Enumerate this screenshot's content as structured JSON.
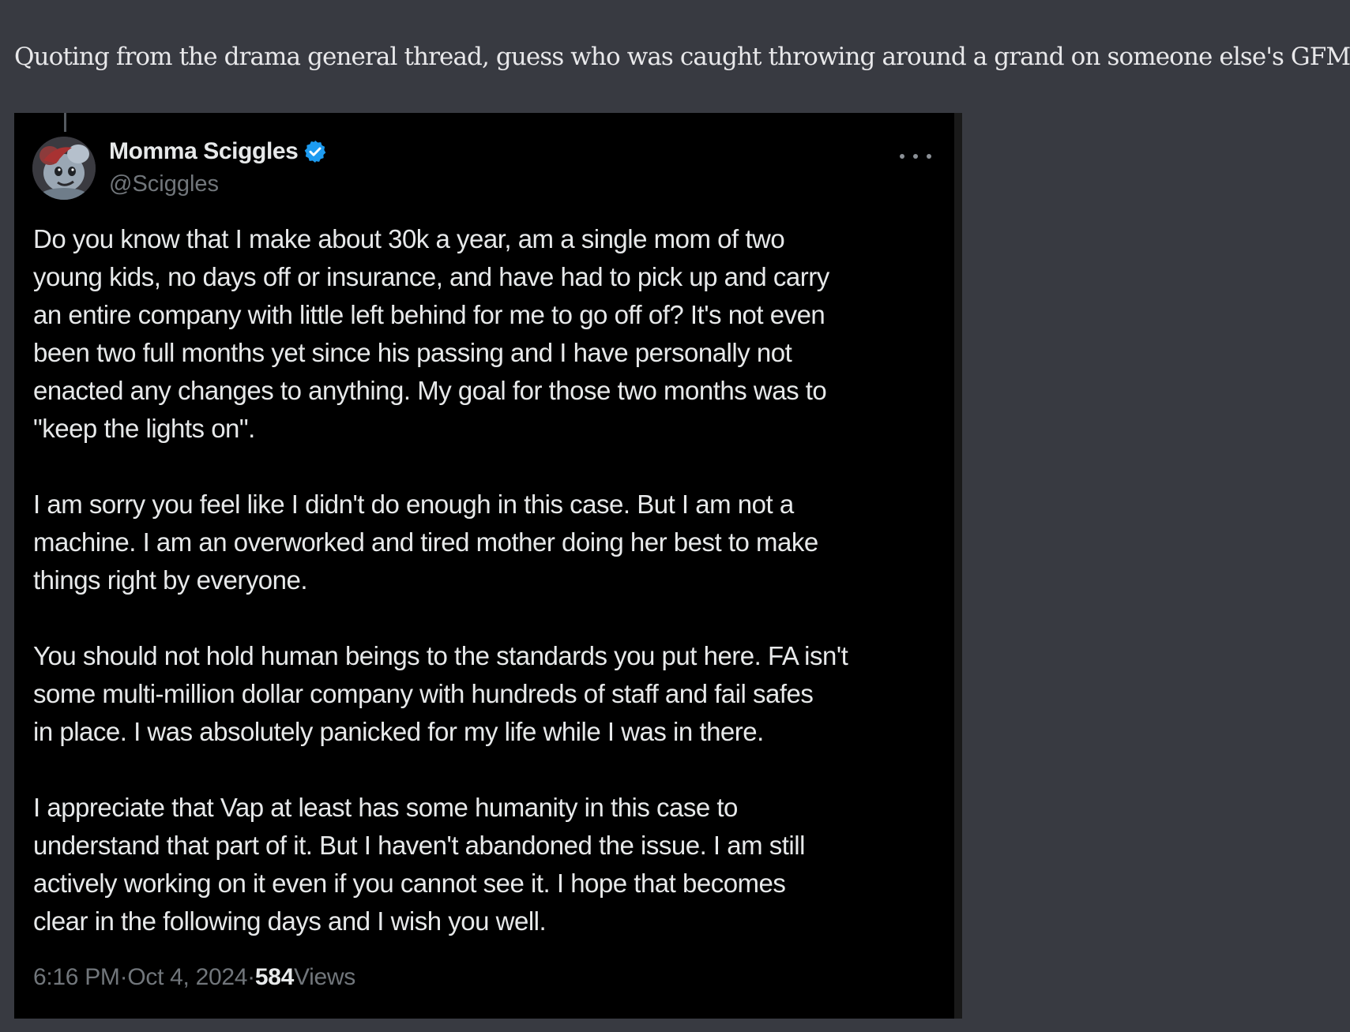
{
  "post": {
    "text": "Quoting from the drama general thread, guess who was caught throwing around a grand on someone else's GFM?"
  },
  "tweet": {
    "display_name": "Momma Sciggles",
    "handle": "@Sciggles",
    "paragraphs": [
      "Do you know that I make about 30k a year, am a single mom of two\nyoung kids, no days off or insurance, and have had to pick up and carry\nan entire company with little left behind for me to go off of? It's not even\nbeen two full months yet since his passing and I have personally not\nenacted any changes to anything. My goal for those two months was to\n\"keep the lights on\".",
      "I am sorry you feel like I didn't do enough in this case. But I am not a\nmachine. I am an overworked and tired mother doing her best to make\nthings right by everyone.",
      "You should not hold human beings to the standards you put here. FA isn't\nsome multi-million dollar company with hundreds of staff and fail safes\nin place. I was absolutely panicked for my life while I was in there.",
      "I appreciate that Vap at least has some humanity in this case to\nunderstand that part of it. But I haven't abandoned the issue. I am still\nactively working on it even if you cannot see it. I hope that becomes\nclear in the following days and I wish you well."
    ],
    "time": "6:16 PM",
    "separator": " · ",
    "date": "Oct 4, 2024",
    "views_count": "584",
    "views_label": " Views",
    "verified_color": "#1d9bf0"
  },
  "icons": {
    "avatar": "avatar-image",
    "verified": "verified-badge-icon",
    "more": "more-options-icon"
  }
}
